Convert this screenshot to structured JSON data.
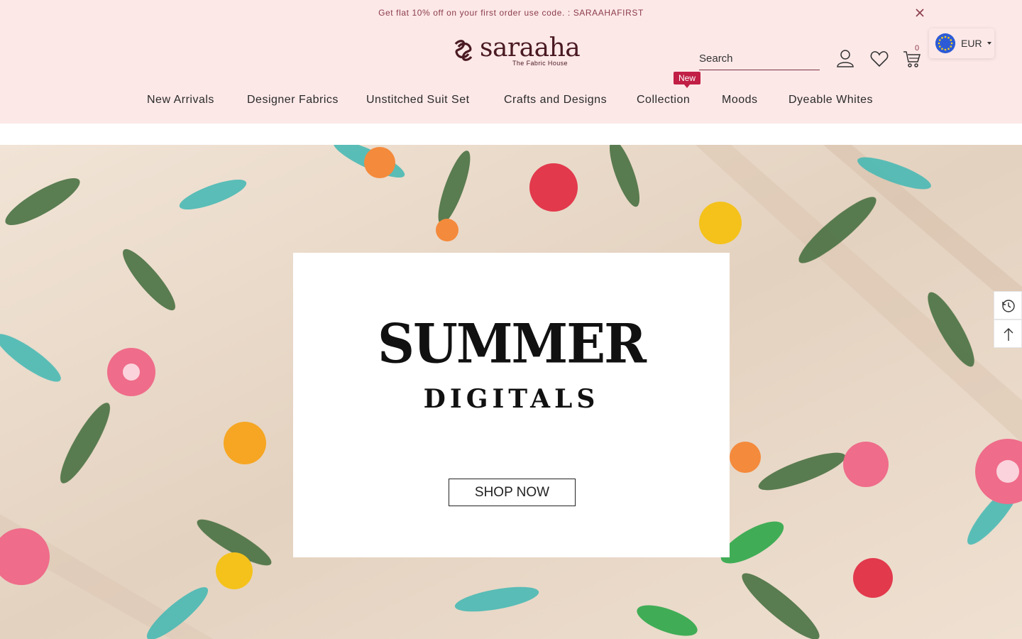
{
  "announcement": {
    "text": "Get flat 10% off on your first order use code. : SARAAHAFIRST"
  },
  "logo": {
    "wordmark": "saraaha",
    "tagline": "The Fabric House"
  },
  "search": {
    "placeholder": "Search"
  },
  "header": {
    "cart_count": "0"
  },
  "currency": {
    "code": "EUR"
  },
  "nav": {
    "items": [
      {
        "label": "New Arrivals"
      },
      {
        "label": "Designer Fabrics"
      },
      {
        "label": "Unstitched Suit Set"
      },
      {
        "label": "Crafts and Designs"
      },
      {
        "label": "Collection",
        "badge": "New"
      },
      {
        "label": "Moods"
      },
      {
        "label": "Dyeable Whites"
      }
    ]
  },
  "hero": {
    "title": "SUMMER",
    "subtitle": "DIGITALS",
    "cta": "SHOP NOW"
  },
  "colors": {
    "header_bg": "#fde8e8",
    "brand": "#4a1a22",
    "badge": "#c11f45"
  }
}
